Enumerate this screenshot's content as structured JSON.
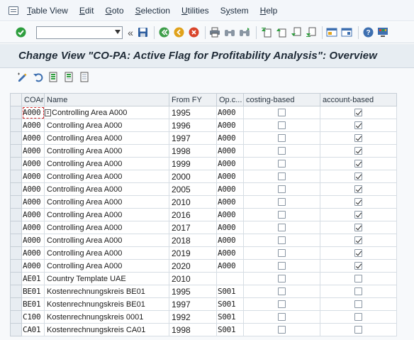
{
  "menubar": {
    "items": [
      "Table View",
      "Edit",
      "Goto",
      "Selection",
      "Utilities",
      "System",
      "Help"
    ],
    "underline": [
      "T",
      "E",
      "G",
      "S",
      "U",
      "y",
      "H"
    ]
  },
  "toolbar": {
    "command_value": ""
  },
  "title": "Change View \"CO-PA: Active Flag for Profitability Analysis\": Overview",
  "table": {
    "headers": [
      "COAr",
      "Name",
      "From FY",
      "Op.c...",
      "costing-based",
      "account-based"
    ],
    "rows": [
      {
        "coar": "A000",
        "name": "Controlling Area A000",
        "fy": "1995",
        "opc": "A000",
        "costing": false,
        "account": true
      },
      {
        "coar": "A000",
        "name": "Controlling Area A000",
        "fy": "1996",
        "opc": "A000",
        "costing": false,
        "account": true
      },
      {
        "coar": "A000",
        "name": "Controlling Area A000",
        "fy": "1997",
        "opc": "A000",
        "costing": false,
        "account": true
      },
      {
        "coar": "A000",
        "name": "Controlling Area A000",
        "fy": "1998",
        "opc": "A000",
        "costing": false,
        "account": true
      },
      {
        "coar": "A000",
        "name": "Controlling Area A000",
        "fy": "1999",
        "opc": "A000",
        "costing": false,
        "account": true
      },
      {
        "coar": "A000",
        "name": "Controlling Area A000",
        "fy": "2000",
        "opc": "A000",
        "costing": false,
        "account": true
      },
      {
        "coar": "A000",
        "name": "Controlling Area A000",
        "fy": "2005",
        "opc": "A000",
        "costing": false,
        "account": true
      },
      {
        "coar": "A000",
        "name": "Controlling Area A000",
        "fy": "2010",
        "opc": "A000",
        "costing": false,
        "account": true
      },
      {
        "coar": "A000",
        "name": "Controlling Area A000",
        "fy": "2016",
        "opc": "A000",
        "costing": false,
        "account": true
      },
      {
        "coar": "A000",
        "name": "Controlling Area A000",
        "fy": "2017",
        "opc": "A000",
        "costing": false,
        "account": true
      },
      {
        "coar": "A000",
        "name": "Controlling Area A000",
        "fy": "2018",
        "opc": "A000",
        "costing": false,
        "account": true
      },
      {
        "coar": "A000",
        "name": "Controlling Area A000",
        "fy": "2019",
        "opc": "A000",
        "costing": false,
        "account": true
      },
      {
        "coar": "A000",
        "name": "Controlling Area A000",
        "fy": "2020",
        "opc": "A000",
        "costing": false,
        "account": true
      },
      {
        "coar": "AE01",
        "name": "Country Template UAE",
        "fy": "2010",
        "opc": "",
        "costing": false,
        "account": false
      },
      {
        "coar": "BE01",
        "name": "Kostenrechnungskreis BE01",
        "fy": "1995",
        "opc": "S001",
        "costing": false,
        "account": false
      },
      {
        "coar": "BE01",
        "name": "Kostenrechnungskreis BE01",
        "fy": "1997",
        "opc": "S001",
        "costing": false,
        "account": false
      },
      {
        "coar": "C100",
        "name": "Kostenrechnungskreis 0001",
        "fy": "1992",
        "opc": "S001",
        "costing": false,
        "account": false
      },
      {
        "coar": "CA01",
        "name": "Kostenrechnungskreis CA01",
        "fy": "1998",
        "opc": "S001",
        "costing": false,
        "account": false
      }
    ]
  },
  "colors": {
    "title_band": "#e7edf2",
    "check_green": "#2e9e3e",
    "focus_red": "#d12b2b"
  }
}
